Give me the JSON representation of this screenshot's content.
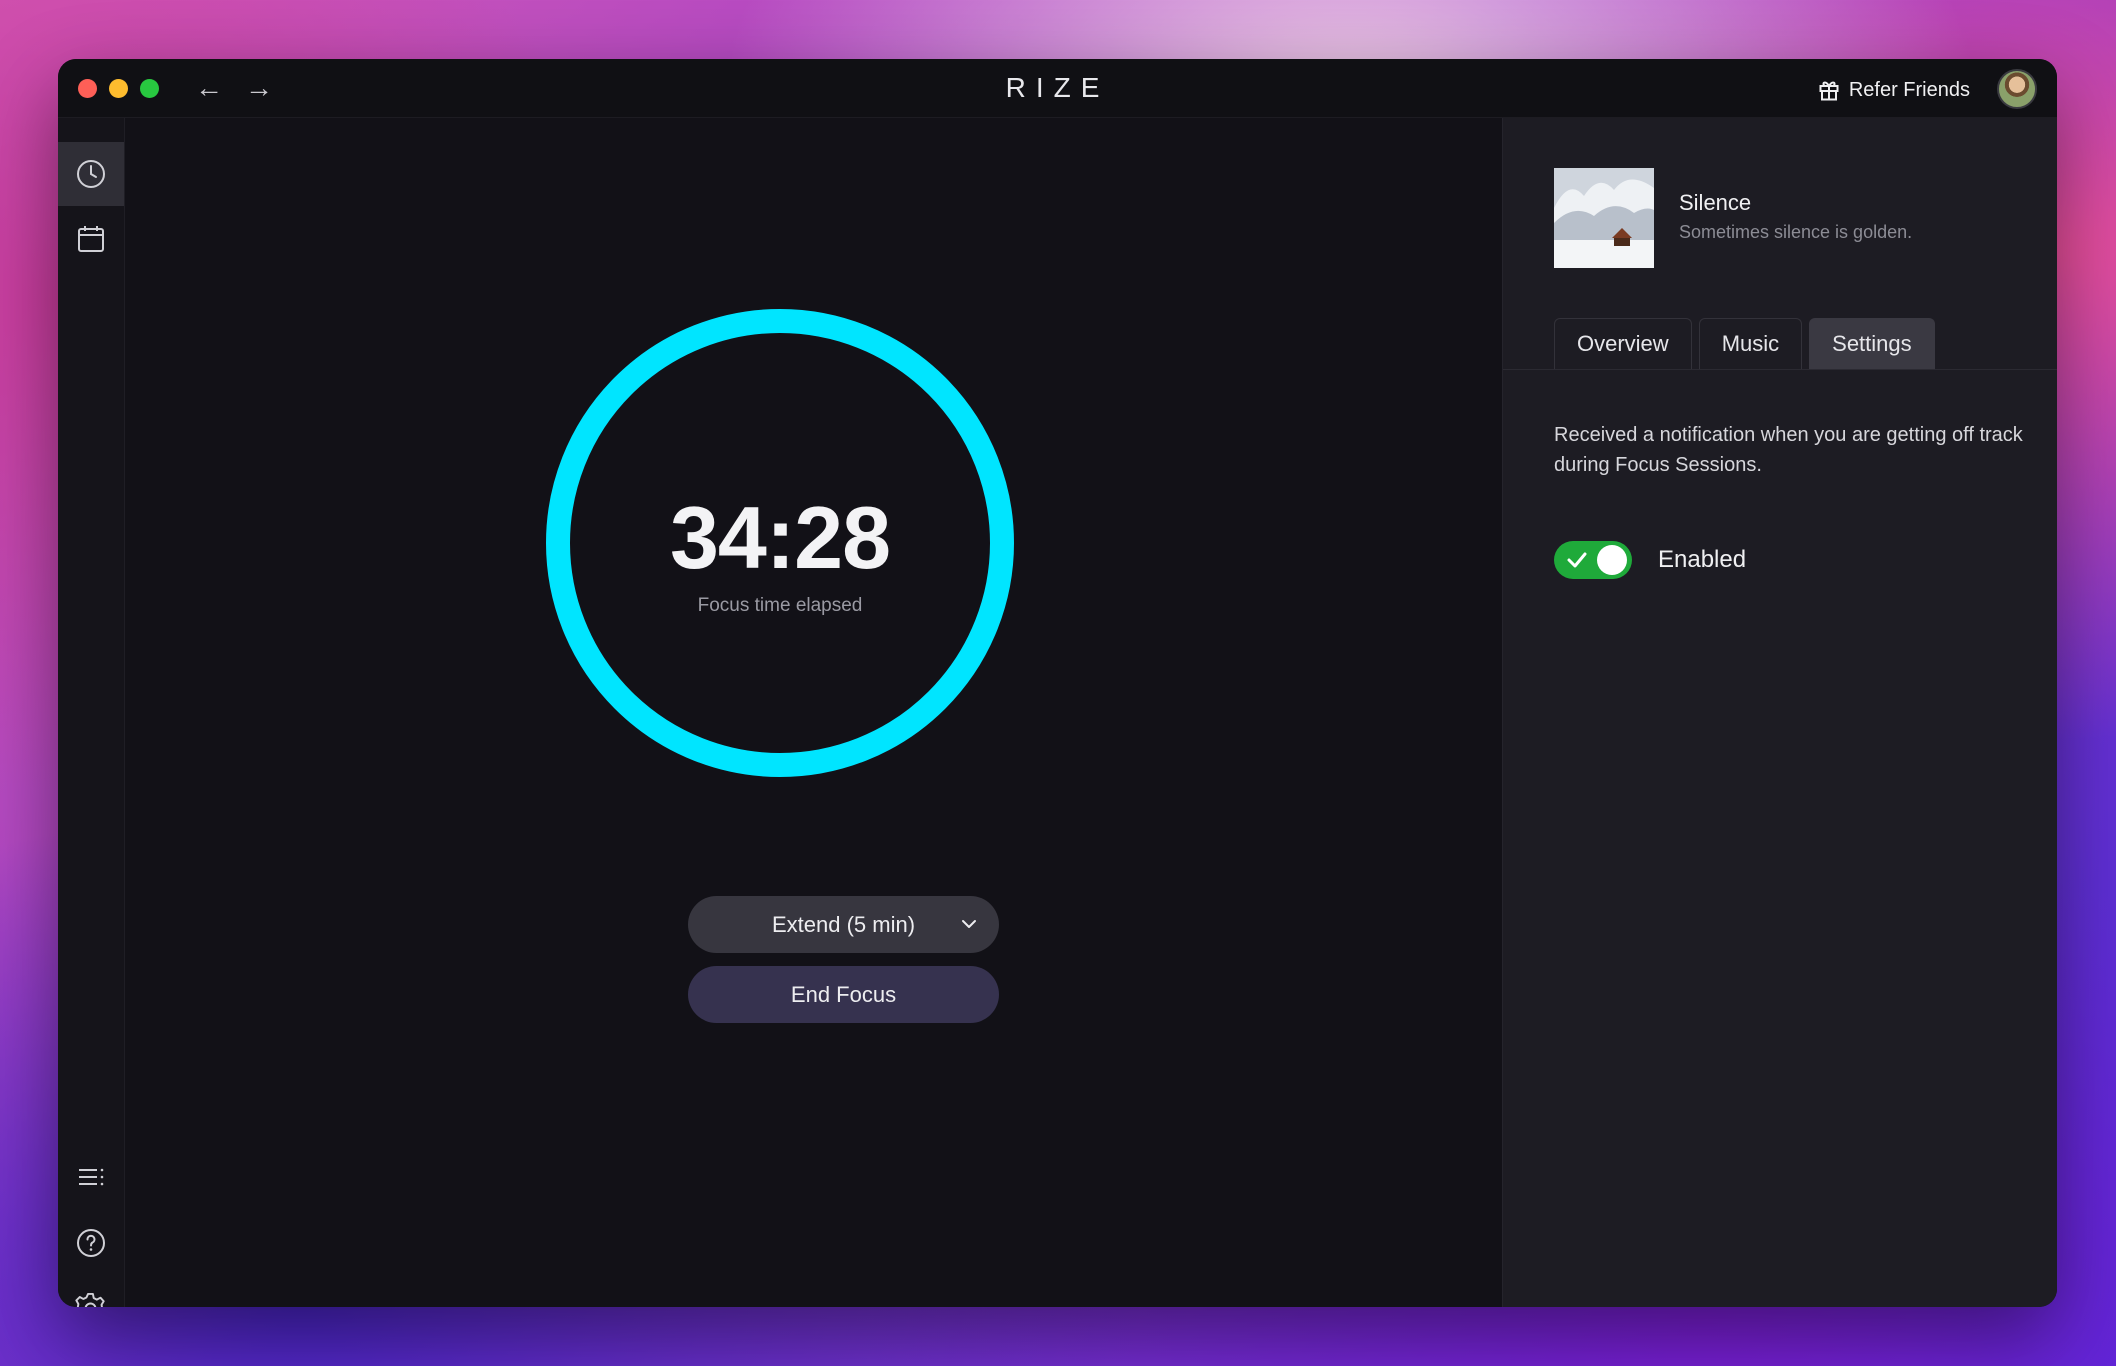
{
  "titlebar": {
    "title": "RIZE",
    "back_arrow": "←",
    "forward_arrow": "→",
    "refer_label": "Refer Friends"
  },
  "sidebar": {
    "top_items": [
      {
        "icon": "clock-icon",
        "active": true
      },
      {
        "icon": "calendar-icon",
        "active": false
      }
    ],
    "bottom_items": [
      {
        "icon": "list-icon"
      },
      {
        "icon": "help-icon"
      },
      {
        "icon": "gear-icon"
      }
    ]
  },
  "focus": {
    "time": "34:28",
    "label": "Focus time elapsed",
    "progress": 1.0,
    "ring_color": "#00e5ff",
    "extend_label": "Extend (5 min)",
    "end_label": "End Focus"
  },
  "panel": {
    "track_title": "Silence",
    "track_subtitle": "Sometimes silence is golden.",
    "tabs": [
      {
        "label": "Overview",
        "active": false
      },
      {
        "label": "Music",
        "active": false
      },
      {
        "label": "Settings",
        "active": true
      }
    ],
    "settings_description": "Received a notification when you are getting off track during Focus Sessions.",
    "toggle_label": "Enabled",
    "toggle_on": true,
    "toggle_color": "#1faa3a"
  }
}
